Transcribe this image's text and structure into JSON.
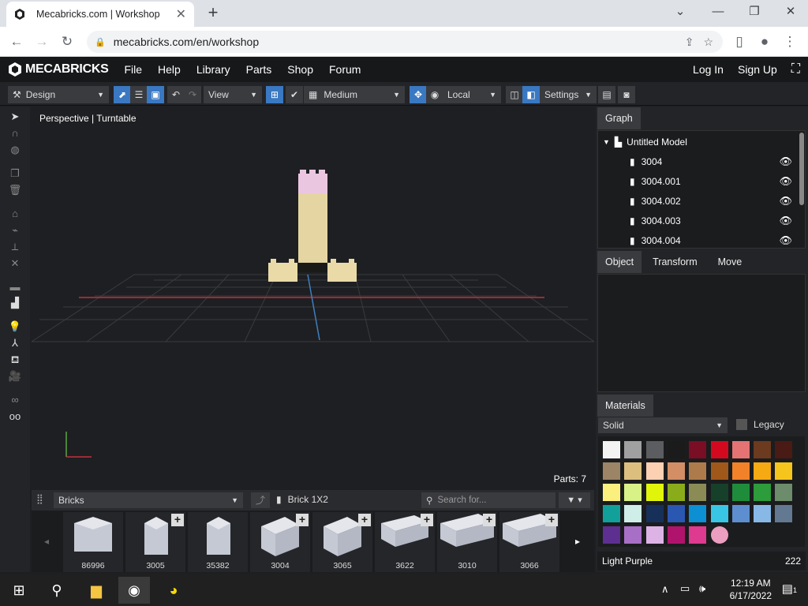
{
  "browser": {
    "tab_title": "Mecabricks.com | Workshop",
    "url": "mecabricks.com/en/workshop"
  },
  "site": {
    "logo": "MECABRICKS",
    "nav": [
      "File",
      "Help",
      "Library",
      "Parts",
      "Shop",
      "Forum"
    ],
    "login": "Log In",
    "signup": "Sign Up"
  },
  "toolbar": {
    "mode": "Design",
    "view": "View",
    "quality": "Medium",
    "space": "Local",
    "settings": "Settings"
  },
  "viewport": {
    "label": "Perspective | Turntable",
    "parts": "Parts: 7"
  },
  "graph": {
    "tab": "Graph",
    "root": "Untitled Model",
    "items": [
      "3004",
      "3004.001",
      "3004.002",
      "3004.003",
      "3004.004"
    ]
  },
  "object_tabs": [
    "Object",
    "Transform",
    "Move"
  ],
  "materials": {
    "tab": "Materials",
    "type": "Solid",
    "legacy_label": "Legacy",
    "selected_name": "Light Purple",
    "selected_id": "222",
    "swatches": [
      "#f2f3f2",
      "#a0a0a0",
      "#5b5d60",
      "#1b1b1b",
      "#7a0e24",
      "#d30a1f",
      "#e57373",
      "#6b3a1f",
      "#4a1a14",
      "#9c8466",
      "#dcbf7f",
      "#fcd1b3",
      "#d38e66",
      "#ad7b4b",
      "#a0571a",
      "#f18229",
      "#f5a912",
      "#f6c51d",
      "#fbf07d",
      "#d9f287",
      "#e0f50a",
      "#8aac1b",
      "#8b8b56",
      "#16402a",
      "#1f8c3c",
      "#2d9c3b",
      "#6c8c6b",
      "#11a19a",
      "#cfeee8",
      "#17305a",
      "#2a57b2",
      "#0d8fd4",
      "#39c6e4",
      "#5d8fd0",
      "#88b8e6",
      "#637891",
      "#5c2f90",
      "#a86fc6",
      "#ddb3e6",
      "#b0136b",
      "#de3a8f",
      "#eb9ec0"
    ]
  },
  "bricks": {
    "category": "Bricks",
    "current": "Brick 1X2",
    "search_placeholder": "Search for...",
    "items": [
      "86996",
      "3005",
      "35382",
      "3004",
      "3065",
      "3622",
      "3010",
      "3066"
    ]
  },
  "taskbar": {
    "time": "12:19 AM",
    "date": "6/17/2022",
    "notifications": "1"
  }
}
